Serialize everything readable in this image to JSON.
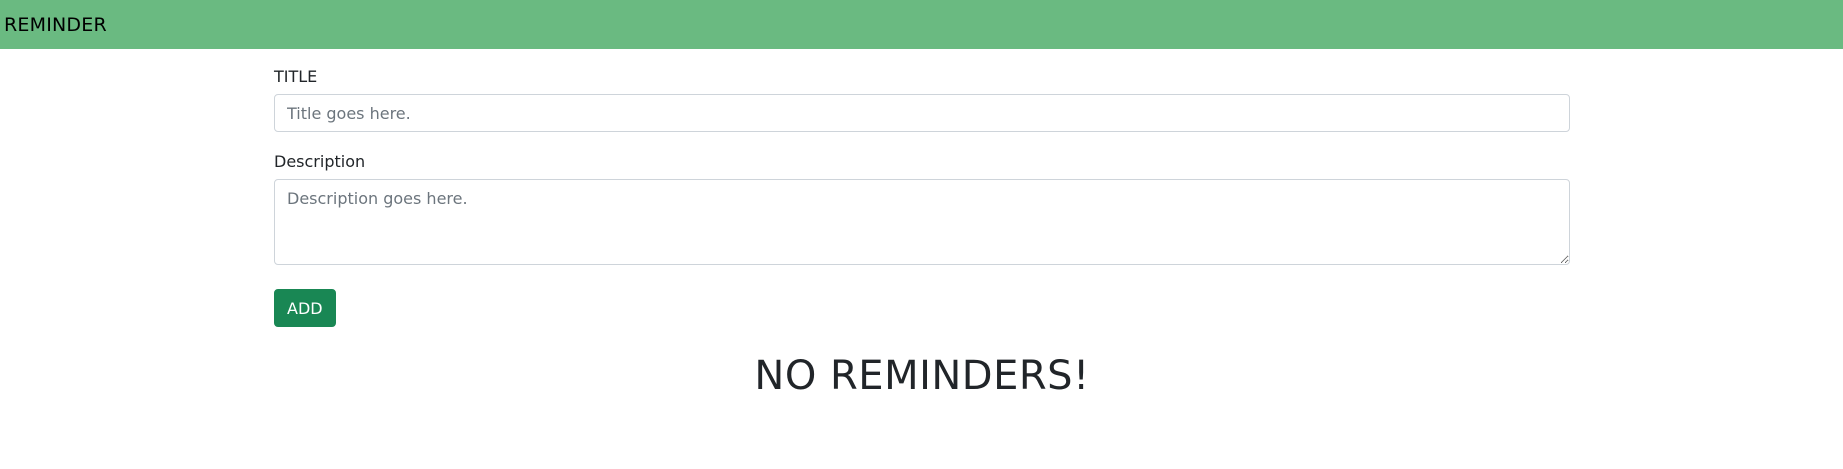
{
  "navbar": {
    "brand": "REMINDER",
    "bg_color": "#6aba81"
  },
  "form": {
    "title_label": "TITLE",
    "title_placeholder": "Title goes here.",
    "title_value": "",
    "description_label": "Description",
    "description_placeholder": "Description goes here.",
    "description_value": "",
    "add_label": "ADD",
    "add_color": "#198754"
  },
  "list": {
    "empty_message": "NO REMINDERS!"
  }
}
